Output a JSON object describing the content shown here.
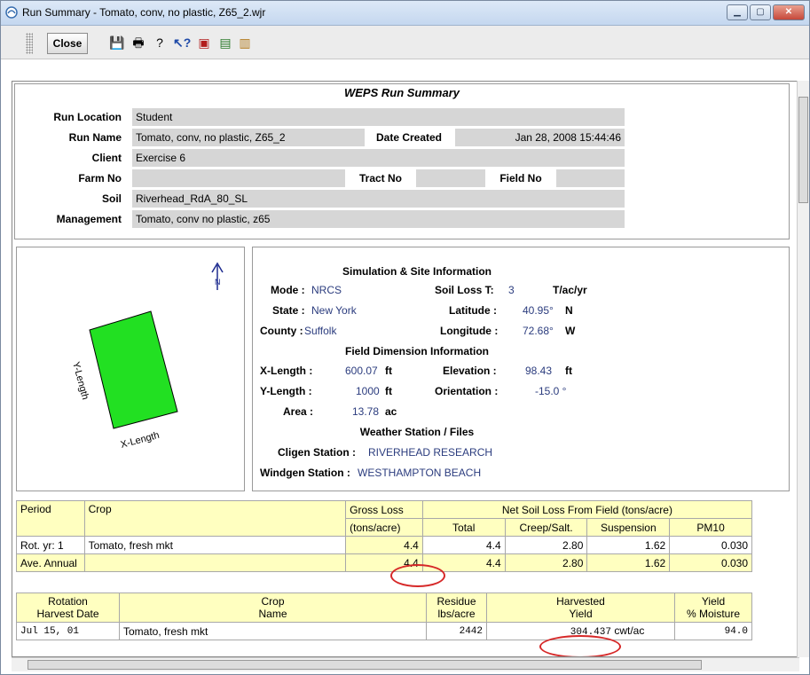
{
  "window": {
    "title": "Run Summary - Tomato, conv, no plastic, Z65_2.wjr"
  },
  "toolbar": {
    "close_label": "Close"
  },
  "summary": {
    "title": "WEPS Run Summary",
    "run_location_label": "Run Location",
    "run_location": "Student",
    "run_name_label": "Run Name",
    "run_name": "Tomato, conv, no plastic, Z65_2",
    "date_created_label": "Date Created",
    "date_created": "Jan 28, 2008 15:44:46",
    "client_label": "Client",
    "client": "Exercise 6",
    "farm_no_label": "Farm No",
    "farm_no": "",
    "tract_no_label": "Tract No",
    "tract_no": "",
    "field_no_label": "Field No",
    "field_no": "",
    "soil_label": "Soil",
    "soil": "Riverhead_RdA_80_SL",
    "management_label": "Management",
    "management": "Tomato, conv no plastic, z65"
  },
  "field_diagram": {
    "north": "N",
    "x_label": "X-Length",
    "y_label": "Y-Length"
  },
  "site": {
    "heading": "Simulation & Site Information",
    "mode_label": "Mode :",
    "mode": "NRCS",
    "soil_loss_t_label": "Soil Loss T:",
    "soil_loss_t": "3",
    "soil_loss_t_unit": "T/ac/yr",
    "state_label": "State :",
    "state": "New York",
    "latitude_label": "Latitude :",
    "latitude": "40.95°",
    "latitude_dir": "N",
    "county_label": "County :",
    "county": "Suffolk",
    "longitude_label": "Longitude :",
    "longitude": "72.68°",
    "longitude_dir": "W",
    "dim_heading": "Field Dimension Information",
    "x_length_label": "X-Length :",
    "x_length": "600.07",
    "x_length_unit": "ft",
    "elevation_label": "Elevation :",
    "elevation": "98.43",
    "elevation_unit": "ft",
    "y_length_label": "Y-Length :",
    "y_length": "1000",
    "y_length_unit": "ft",
    "orientation_label": "Orientation :",
    "orientation": "-15.0 °",
    "area_label": "Area :",
    "area": "13.78",
    "area_unit": "ac",
    "weather_heading": "Weather Station / Files",
    "cligen_label": "Cligen Station :",
    "cligen": "RIVERHEAD RESEARCH",
    "windgen_label": "Windgen Station :",
    "windgen": "WESTHAMPTON BEACH"
  },
  "loss_table": {
    "h_period": "Period",
    "h_crop": "Crop",
    "h_gross": "Gross Loss",
    "h_gross_unit": "(tons/acre)",
    "h_net": "Net Soil Loss From Field (tons/acre)",
    "h_total": "Total",
    "h_creep": "Creep/Salt.",
    "h_susp": "Suspension",
    "h_pm10": "PM10",
    "rows": [
      {
        "period": "Rot. yr: 1",
        "crop": "Tomato, fresh mkt",
        "gross": "4.4",
        "total": "4.4",
        "creep": "2.80",
        "susp": "1.62",
        "pm10": "0.030"
      },
      {
        "period": "Ave. Annual",
        "crop": "",
        "gross": "4.4",
        "total": "4.4",
        "creep": "2.80",
        "susp": "1.62",
        "pm10": "0.030"
      }
    ]
  },
  "harvest_table": {
    "h_date1": "Rotation",
    "h_date2": "Harvest Date",
    "h_crop1": "Crop",
    "h_crop2": "Name",
    "h_res1": "Residue",
    "h_res2": "lbs/acre",
    "h_yield1": "Harvested",
    "h_yield2": "Yield",
    "h_moist1": "Yield",
    "h_moist2": "% Moisture",
    "rows": [
      {
        "date": "Jul 15, 01",
        "crop": "Tomato, fresh mkt",
        "residue": "2442",
        "yield": "304.437",
        "yield_unit": "cwt/ac",
        "moisture": "94.0"
      }
    ]
  }
}
